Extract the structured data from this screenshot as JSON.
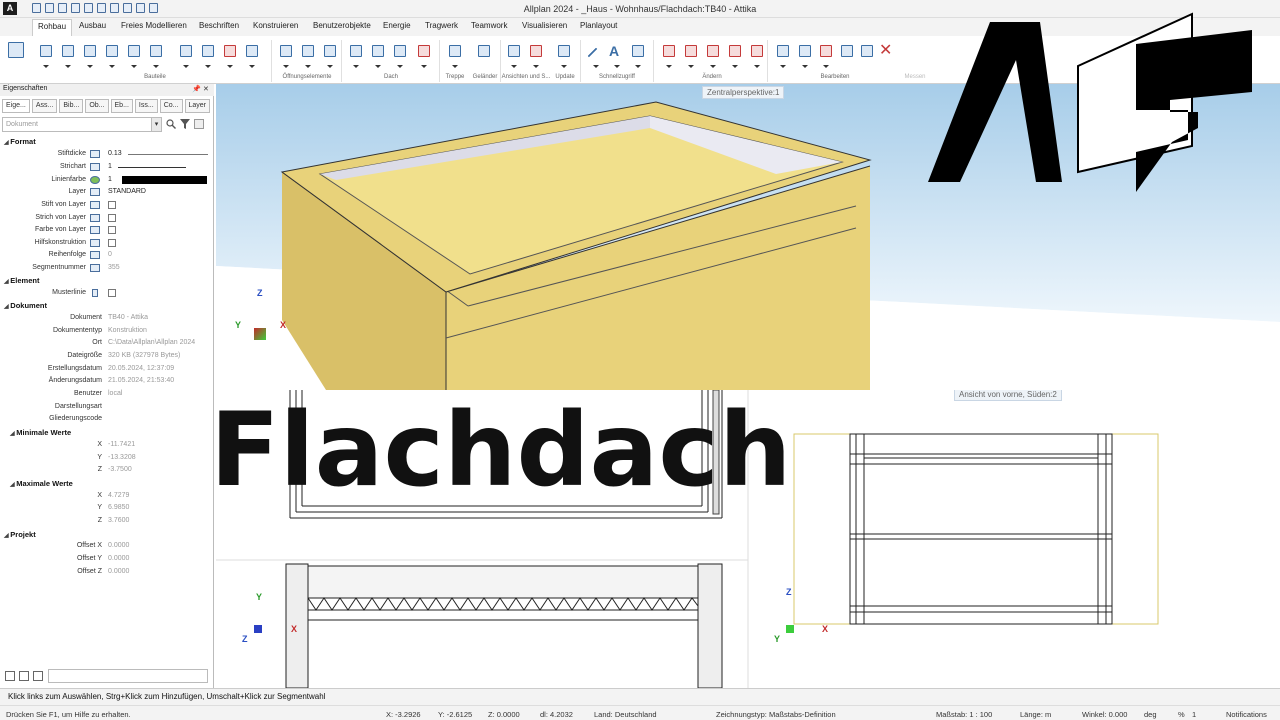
{
  "app": {
    "logo_letter": "A",
    "title": "Allplan 2024 - _Haus - Wohnhaus/Flachdach:TB40 - Attika"
  },
  "ribbon": {
    "tabs": [
      "Rohbau",
      "Ausbau",
      "Freies Modellieren",
      "Beschriften",
      "Konstruieren",
      "Benutzerobjekte",
      "Energie",
      "Tragwerk",
      "Teamwork",
      "Visualisieren",
      "Planlayout"
    ],
    "active_tab": "Rohbau",
    "groups": [
      "Bauteile",
      "Öffnungselemente",
      "Dach",
      "Treppe",
      "Geländer",
      "Ansichten und S...",
      "Update",
      "Schnellzugriff",
      "Ändern",
      "Bearbeiten",
      "Messen",
      "Aktionen"
    ]
  },
  "panel": {
    "title": "Eigenschaften",
    "pin_icon": "pin-icon",
    "close_icon": "close-icon",
    "tabs": [
      "Eige...",
      "Ass...",
      "Bib...",
      "Ob...",
      "Eb...",
      "Iss...",
      "Co...",
      "Layer"
    ],
    "filter_placeholder": "Dokument",
    "sections": {
      "format": "Format",
      "element": "Element",
      "dokument": "Dokument",
      "projekt": "Projekt"
    },
    "format_rows": [
      {
        "label": "Stiftdicke",
        "value": "0.13"
      },
      {
        "label": "Strichart",
        "value": "1"
      },
      {
        "label": "Linienfarbe",
        "value": "1"
      },
      {
        "label": "Layer",
        "value": "STANDARD"
      },
      {
        "label": "Stift von Layer",
        "value": ""
      },
      {
        "label": "Strich von Layer",
        "value": ""
      },
      {
        "label": "Farbe von Layer",
        "value": ""
      },
      {
        "label": "Hilfskonstruktion",
        "value": ""
      },
      {
        "label": "Reihenfolge",
        "value": "0"
      },
      {
        "label": "Segmentnummer",
        "value": "355"
      }
    ],
    "element_rows": [
      {
        "label": "Musterlinie",
        "value": ""
      }
    ],
    "dokument_rows": [
      {
        "label": "Dokument",
        "value": "TB40 - Attika"
      },
      {
        "label": "Dokumententyp",
        "value": "Konstruktion"
      },
      {
        "label": "Ort",
        "value": "C:\\Data\\Allplan\\Allplan 2024"
      },
      {
        "label": "Dateigröße",
        "value": "320 KB (327978 Bytes)"
      },
      {
        "label": "Erstellungsdatum",
        "value": "20.05.2024, 12:37:09"
      },
      {
        "label": "Änderungsdatum",
        "value": "21.05.2024, 21:53:40"
      },
      {
        "label": "Benutzer",
        "value": "local"
      },
      {
        "label": "Darstellungsart",
        "value": ""
      },
      {
        "label": "Gliederungscode",
        "value": ""
      }
    ],
    "min_label": "Minimale Werte",
    "min_values": [
      {
        "label": "X",
        "value": "-11.7421"
      },
      {
        "label": "Y",
        "value": "-13.3208"
      },
      {
        "label": "Z",
        "value": "-3.7500"
      }
    ],
    "max_label": "Maximale Werte",
    "max_values": [
      {
        "label": "X",
        "value": "4.7279"
      },
      {
        "label": "Y",
        "value": "6.9850"
      },
      {
        "label": "Z",
        "value": "3.7600"
      }
    ],
    "projekt_rows": [
      {
        "label": "Offset X",
        "value": "0.0000"
      },
      {
        "label": "Offset Y",
        "value": "0.0000"
      },
      {
        "label": "Offset Z",
        "value": "0.0000"
      }
    ]
  },
  "viewport": {
    "label_3d": "Zentralperspektive:1",
    "label_front": "Ansicht von vorne, Süden:2",
    "overlay_title": "Flachdach",
    "axes": {
      "x": "X",
      "y": "Y",
      "z": "Z"
    }
  },
  "status": {
    "hint": "Klick links zum Auswählen, Strg+Klick zum Hinzufügen, Umschalt+Klick zur Segmentwahl",
    "help": "Drücken Sie F1, um Hilfe zu erhalten.",
    "x": "X:   -3.2926",
    "y": "Y:   -2.6125",
    "z": "Z:   0.0000",
    "dl": "dl:   4.2032",
    "land": "Land:   Deutschland",
    "zeichnungstyp": "Zeichnungstyp:   Maßstabs-Definition",
    "massstab": "Maßstab:   1 : 100",
    "laenge": "Länge:   m",
    "winkel": "Winkel:   0.000",
    "deg": "deg",
    "percent": "%",
    "one": "1",
    "notifications": "Notifications"
  },
  "colors": {
    "insulation": "#e8d27a",
    "wall_blue": "#3aa7b8",
    "sky_top": "#a7cde9",
    "accent_blue": "#3b6ea5"
  }
}
